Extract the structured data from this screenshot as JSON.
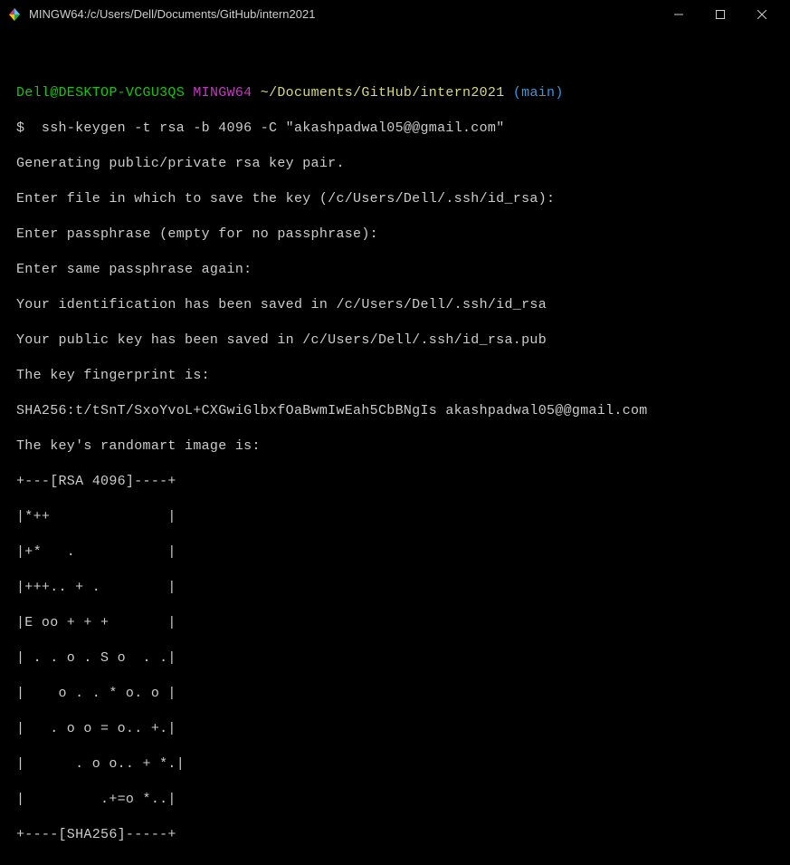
{
  "titlebar": {
    "title": "MINGW64:/c/Users/Dell/Documents/GitHub/intern2021"
  },
  "prompt": {
    "user": "Dell@DESKTOP-VCGU3QS",
    "host": "MINGW64",
    "path": "~/Documents/GitHub/intern2021",
    "branch": "(main)",
    "symbol": "$",
    "command": "ssh-keygen -t rsa -b 4096 -C \"akashpadwal05@@gmail.com\""
  },
  "output": {
    "l1": "Generating public/private rsa key pair.",
    "l2": "Enter file in which to save the key (/c/Users/Dell/.ssh/id_rsa):",
    "l3": "Enter passphrase (empty for no passphrase):",
    "l4": "Enter same passphrase again:",
    "l5": "Your identification has been saved in /c/Users/Dell/.ssh/id_rsa",
    "l6": "Your public key has been saved in /c/Users/Dell/.ssh/id_rsa.pub",
    "l7": "The key fingerprint is:",
    "l8": "SHA256:t/tSnT/SxoYvoL+CXGwiGlbxfOaBwmIwEah5CbBNgIs akashpadwal05@@gmail.com",
    "l9": "The key's randomart image is:",
    "r1": "+---[RSA 4096]----+",
    "r2": "|*++              |",
    "r3": "|+*   .           |",
    "r4": "|+++.. + .        |",
    "r5": "|E oo + + +       |",
    "r6": "| . . o . S o  . .|",
    "r7": "|    o . . * o. o |",
    "r8": "|   . o o = o.. +.|",
    "r9": "|      . o o.. + *.|",
    "r10": "|         .+=o *..|",
    "r11": "+----[SHA256]-----+"
  }
}
